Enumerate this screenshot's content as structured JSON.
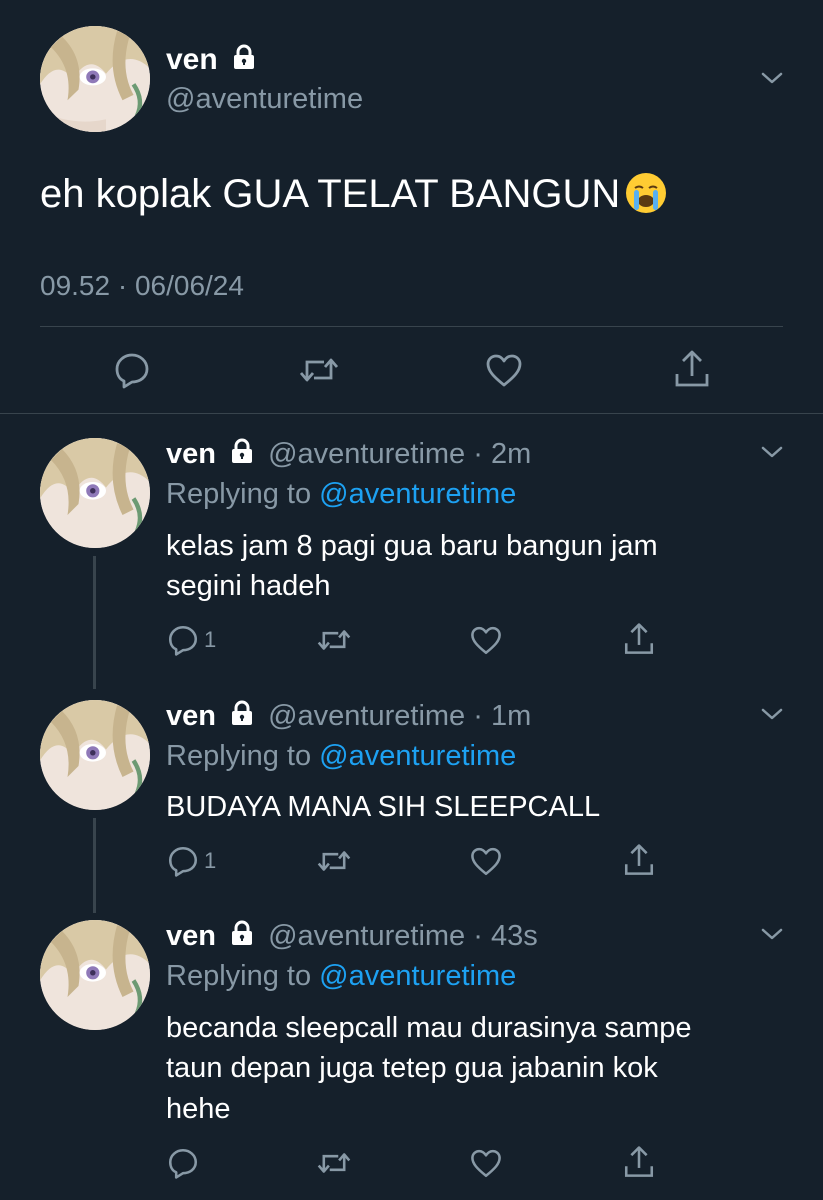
{
  "main_tweet": {
    "name": "ven",
    "handle": "@aventuretime",
    "text": "eh koplak GUA TELAT BANGUN",
    "emoji": "😭",
    "timestamp": "09.52 · 06/06/24"
  },
  "replies": [
    {
      "name": "ven",
      "handle": "@aventuretime",
      "time": "· 2m",
      "replying_label": "Replying to",
      "replying_handle": "@aventuretime",
      "text_lines": [
        "kelas jam 8 pagi gua baru bangun jam",
        "segini hadeh"
      ],
      "reply_count": "1"
    },
    {
      "name": "ven",
      "handle": "@aventuretime",
      "time": "· 1m",
      "replying_label": "Replying to",
      "replying_handle": "@aventuretime",
      "text_lines": [
        "BUDAYA MANA SIH SLEEPCALL"
      ],
      "reply_count": "1"
    },
    {
      "name": "ven",
      "handle": "@aventuretime",
      "time": "· 43s",
      "replying_label": "Replying to",
      "replying_handle": "@aventuretime",
      "text_lines": [
        "becanda sleepcall mau durasinya sampe",
        "taun depan juga tetep gua jabanin kok",
        "hehe"
      ],
      "reply_count": ""
    }
  ],
  "icons": {
    "lock": "lock-icon",
    "chevron": "chevron-down-icon",
    "reply": "reply-icon",
    "retweet": "retweet-icon",
    "like": "heart-icon",
    "share": "share-icon"
  },
  "colors": {
    "background": "#15202b",
    "text": "#ffffff",
    "muted": "#8899a6",
    "link": "#1da1f2",
    "divider": "#38444d"
  }
}
